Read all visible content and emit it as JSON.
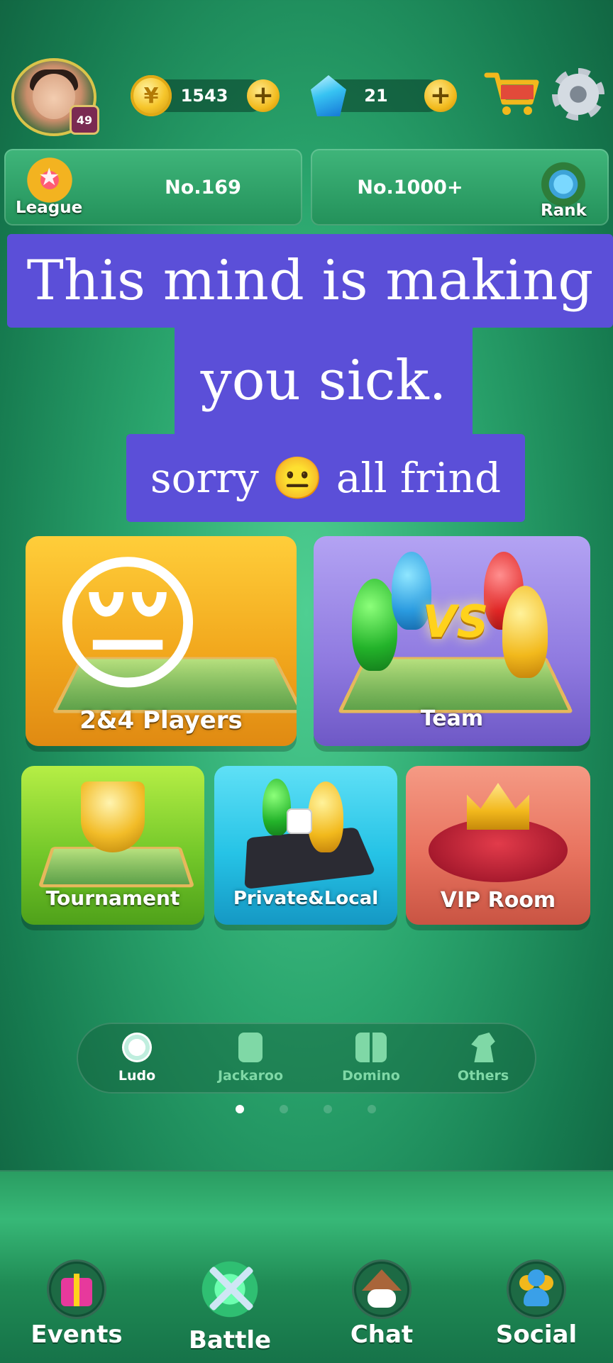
{
  "profile": {
    "level": "49"
  },
  "currency": {
    "coins": "1543",
    "gems": "21"
  },
  "rank_strip": {
    "league_label": "League",
    "league_position": "No.169",
    "rank_position": "No.1000+",
    "rank_label": "Rank"
  },
  "caption": {
    "line1": "This mind is making",
    "line2": "you sick.",
    "line3": "sorry 😐 all frind"
  },
  "overlay_emoji": "😔",
  "modes": {
    "players": "2&4 Players",
    "team": "Team",
    "tournament": "Tournament",
    "private_local": "Private&Local",
    "vip_room": "VIP Room"
  },
  "team_vs_text": "VS",
  "game_switcher": {
    "items": [
      {
        "label": "Ludo",
        "active": true
      },
      {
        "label": "Jackaroo",
        "active": false
      },
      {
        "label": "Domino",
        "active": false
      },
      {
        "label": "Others",
        "active": false
      }
    ]
  },
  "bottom_nav": {
    "events": "Events",
    "battle": "Battle",
    "chat": "Chat",
    "social": "Social"
  },
  "colors": {
    "caption_bg": "#5b4fd8",
    "players_card": "#f2a81d",
    "team_card": "#8f7ae0",
    "tournament_card": "#74c82a",
    "private_card": "#26c3e6",
    "vip_card": "#e8735f"
  }
}
